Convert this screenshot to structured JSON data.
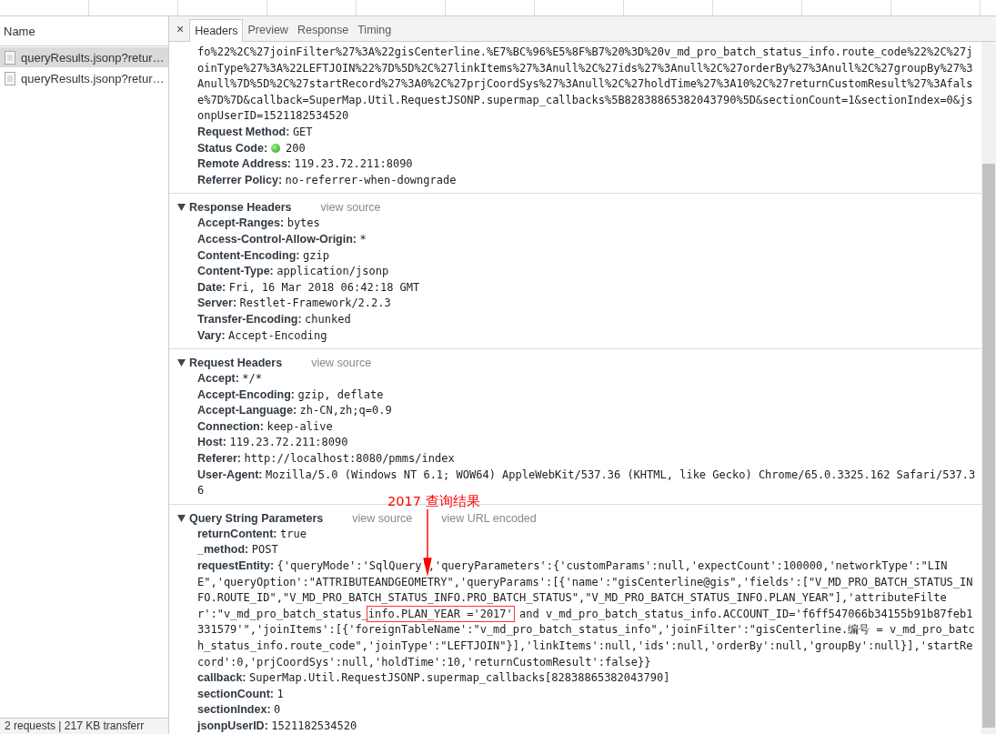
{
  "request_list": {
    "header": "Name",
    "items": [
      {
        "name": "queryResults.jsonp?retur…",
        "selected": true
      },
      {
        "name": "queryResults.jsonp?retur…",
        "selected": false
      }
    ],
    "status": "2 requests | 217 KB transferr"
  },
  "details": {
    "close": "×",
    "tabs": [
      {
        "label": "Headers",
        "selected": true
      },
      {
        "label": "Preview",
        "selected": false
      },
      {
        "label": "Response",
        "selected": false
      },
      {
        "label": "Timing",
        "selected": false
      }
    ],
    "url_tail": "fo%22%2C%27joinFilter%27%3A%22gisCenterline.%E7%BC%96%E5%8F%B7%20%3D%20v_md_pro_batch_status_info.route_code%22%2C%27joinType%27%3A%22LEFTJOIN%22%7D%5D%2C%27linkItems%27%3Anull%2C%27ids%27%3Anull%2C%27orderBy%27%3Anull%2C%27groupBy%27%3Anull%7D%5D%2C%27startRecord%27%3A0%2C%27prjCoordSys%27%3Anull%2C%27holdTime%27%3A10%2C%27returnCustomResult%27%3Afalse%7D%7D&callback=SuperMap.Util.RequestJSONP.supermap_callbacks%5B82838865382043790%5D&sectionCount=1&sectionIndex=0&jsonpUserID=1521182534520",
    "general": [
      {
        "key": "Request Method:",
        "value": "GET",
        "kind": "text"
      },
      {
        "key": "Status Code:",
        "value": "200",
        "kind": "status"
      },
      {
        "key": "Remote Address:",
        "value": "119.23.72.211:8090",
        "kind": "text"
      },
      {
        "key": "Referrer Policy:",
        "value": "no-referrer-when-downgrade",
        "kind": "text"
      }
    ],
    "sections": [
      {
        "title": "Response Headers",
        "expanded": true,
        "links": [
          "view source"
        ],
        "fields": [
          {
            "key": "Accept-Ranges:",
            "value": "bytes"
          },
          {
            "key": "Access-Control-Allow-Origin:",
            "value": "*"
          },
          {
            "key": "Content-Encoding:",
            "value": "gzip"
          },
          {
            "key": "Content-Type:",
            "value": "application/jsonp"
          },
          {
            "key": "Date:",
            "value": "Fri, 16 Mar 2018 06:42:18 GMT"
          },
          {
            "key": "Server:",
            "value": "Restlet-Framework/2.2.3"
          },
          {
            "key": "Transfer-Encoding:",
            "value": "chunked"
          },
          {
            "key": "Vary:",
            "value": "Accept-Encoding"
          }
        ]
      },
      {
        "title": "Request Headers",
        "expanded": true,
        "links": [
          "view source"
        ],
        "fields": [
          {
            "key": "Accept:",
            "value": "*/*"
          },
          {
            "key": "Accept-Encoding:",
            "value": "gzip, deflate"
          },
          {
            "key": "Accept-Language:",
            "value": "zh-CN,zh;q=0.9"
          },
          {
            "key": "Connection:",
            "value": "keep-alive"
          },
          {
            "key": "Host:",
            "value": "119.23.72.211:8090"
          },
          {
            "key": "Referer:",
            "value": "http://localhost:8080/pmms/index"
          },
          {
            "key": "User-Agent:",
            "value": "Mozilla/5.0 (Windows NT 6.1; WOW64) AppleWebKit/537.36 (KHTML, like Gecko) Chrome/65.0.3325.162 Safari/537.36"
          }
        ]
      },
      {
        "title": "Query String Parameters",
        "expanded": true,
        "links": [
          "view source",
          "view URL encoded"
        ],
        "fields": [
          {
            "key": "returnContent:",
            "value": "true"
          },
          {
            "key": "_method:",
            "value": "POST"
          },
          {
            "key": "requestEntity:",
            "parts": [
              {
                "highlighted": false,
                "text": "{'queryMode':'SqlQuery','queryParameters':{'customParams':null,'expectCount':100000,'networkType':\"LINE\",'queryOption':\"ATTRIBUTEANDGEOMETRY\",'queryParams':[{'name':\"gisCenterline@gis\",'fields':[\"V_MD_PRO_BATCH_STATUS_INFO.ROUTE_ID\",\"V_MD_PRO_BATCH_STATUS_INFO.PRO_BATCH_STATUS\",\"V_MD_PRO_BATCH_STATUS_INFO.PLAN_YEAR\"],'attributeFilter':\"v_md_pro_batch_status_"
              },
              {
                "highlighted": true,
                "text": "info.PLAN_YEAR ='2017'"
              },
              {
                "highlighted": false,
                "text": " and v_md_pro_batch_status_info.ACCOUNT_ID='f6ff547066b34155b91b87feb1331579'\",'joinItems':[{'foreignTableName':\"v_md_pro_batch_status_info\",'joinFilter':\"gisCenterline.编号 = v_md_pro_batch_status_info.route_code\",'joinType':\"LEFTJOIN\"}],'linkItems':null,'ids':null,'orderBy':null,'groupBy':null}],'startRecord':0,'prjCoordSys':null,'holdTime':10,'returnCustomResult':false}}"
              }
            ]
          },
          {
            "key": "callback:",
            "value": "SuperMap.Util.RequestJSONP.supermap_callbacks[82838865382043790]"
          },
          {
            "key": "sectionCount:",
            "value": "1"
          },
          {
            "key": "sectionIndex:",
            "value": "0"
          },
          {
            "key": "jsonpUserID:",
            "value": "1521182534520"
          }
        ]
      }
    ]
  },
  "annotation": {
    "label": "2017 查询结果"
  }
}
